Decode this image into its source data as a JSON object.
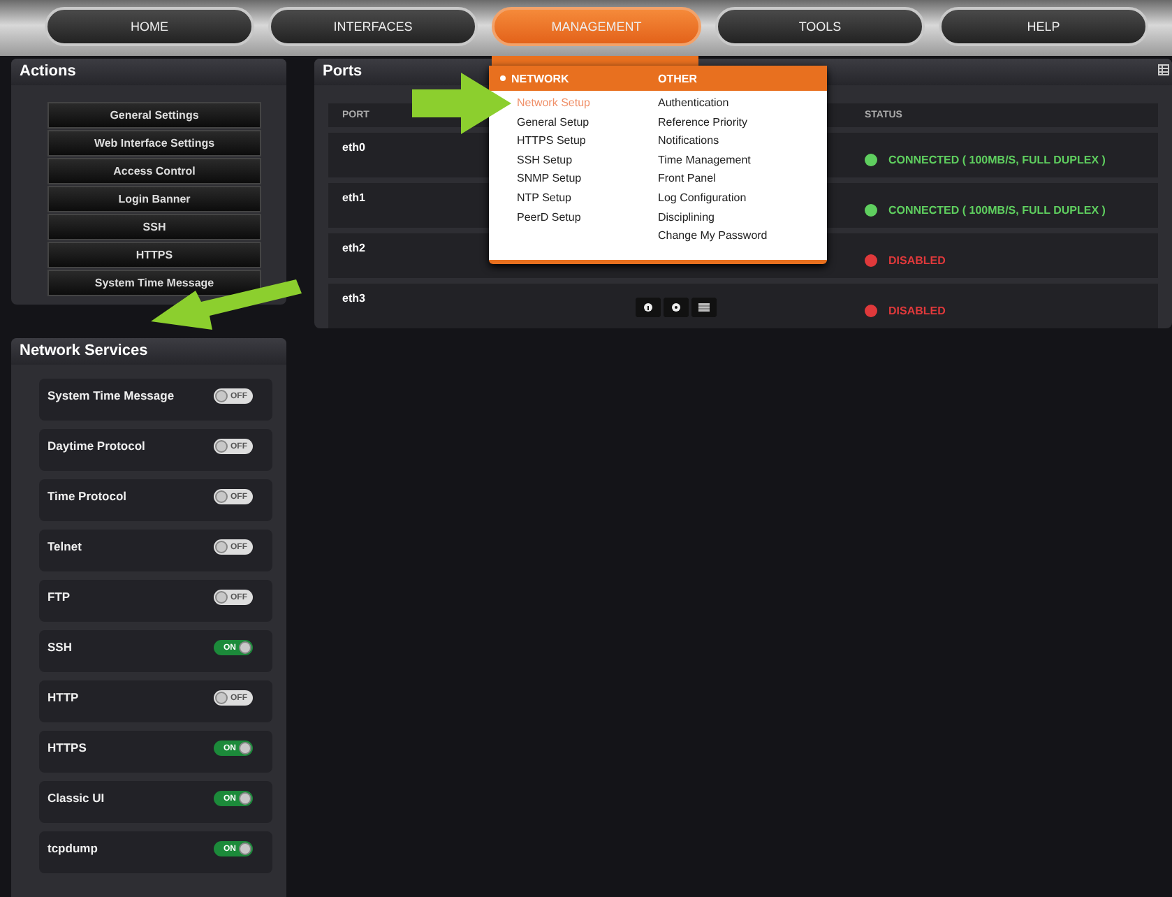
{
  "nav": {
    "tabs": [
      {
        "label": "HOME",
        "selected": false
      },
      {
        "label": "INTERFACES",
        "selected": false
      },
      {
        "label": "MANAGEMENT",
        "selected": true
      },
      {
        "label": "TOOLS",
        "selected": false
      },
      {
        "label": "HELP",
        "selected": false
      }
    ]
  },
  "menu": {
    "sections": [
      {
        "heading": "NETWORK",
        "selected": true,
        "items": [
          {
            "label": "Network Setup",
            "selected": true
          },
          {
            "label": "General Setup",
            "selected": false
          },
          {
            "label": "HTTPS Setup",
            "selected": false
          },
          {
            "label": "SSH Setup",
            "selected": false
          },
          {
            "label": "SNMP Setup",
            "selected": false
          },
          {
            "label": "NTP Setup",
            "selected": false
          },
          {
            "label": "PeerD Setup",
            "selected": false
          }
        ]
      },
      {
        "heading": "OTHER",
        "selected": false,
        "items": [
          {
            "label": "Authentication",
            "selected": false
          },
          {
            "label": "Reference Priority",
            "selected": false
          },
          {
            "label": "Notifications",
            "selected": false
          },
          {
            "label": "Time Management",
            "selected": false
          },
          {
            "label": "Front Panel",
            "selected": false
          },
          {
            "label": "Log Configuration",
            "selected": false
          },
          {
            "label": "Disciplining",
            "selected": false
          },
          {
            "label": "Change My Password",
            "selected": false
          }
        ]
      }
    ]
  },
  "actions": {
    "title": "Actions",
    "buttons": [
      "General Settings",
      "Web Interface Settings",
      "Access Control",
      "Login Banner",
      "SSH",
      "HTTPS",
      "System Time Message"
    ]
  },
  "services": {
    "title": "Network Services",
    "items": [
      {
        "name": "System Time Message",
        "on": false,
        "toggle_label": "OFF"
      },
      {
        "name": "Daytime Protocol",
        "on": false,
        "toggle_label": "OFF"
      },
      {
        "name": "Time Protocol",
        "on": false,
        "toggle_label": "OFF"
      },
      {
        "name": "Telnet",
        "on": false,
        "toggle_label": "OFF"
      },
      {
        "name": "FTP",
        "on": false,
        "toggle_label": "OFF"
      },
      {
        "name": "SSH",
        "on": true,
        "toggle_label": "ON"
      },
      {
        "name": "HTTP",
        "on": false,
        "toggle_label": "OFF"
      },
      {
        "name": "HTTPS",
        "on": true,
        "toggle_label": "ON"
      },
      {
        "name": "Classic UI",
        "on": true,
        "toggle_label": "ON"
      },
      {
        "name": "tcpdump",
        "on": true,
        "toggle_label": "ON"
      }
    ]
  },
  "ports": {
    "title": "Ports",
    "columns": [
      "PORT",
      "STATUS"
    ],
    "rows": [
      {
        "port": "eth0",
        "kind": "connected",
        "status": "CONNECTED ( 100MB/S, FULL DUPLEX )",
        "show_actions": false
      },
      {
        "port": "eth1",
        "kind": "connected",
        "status": "CONNECTED ( 100MB/S, FULL DUPLEX )",
        "show_actions": false
      },
      {
        "port": "eth2",
        "kind": "disabled",
        "status": "DISABLED",
        "show_actions": false
      },
      {
        "port": "eth3",
        "kind": "disabled",
        "status": "DISABLED",
        "show_actions": true
      }
    ]
  }
}
